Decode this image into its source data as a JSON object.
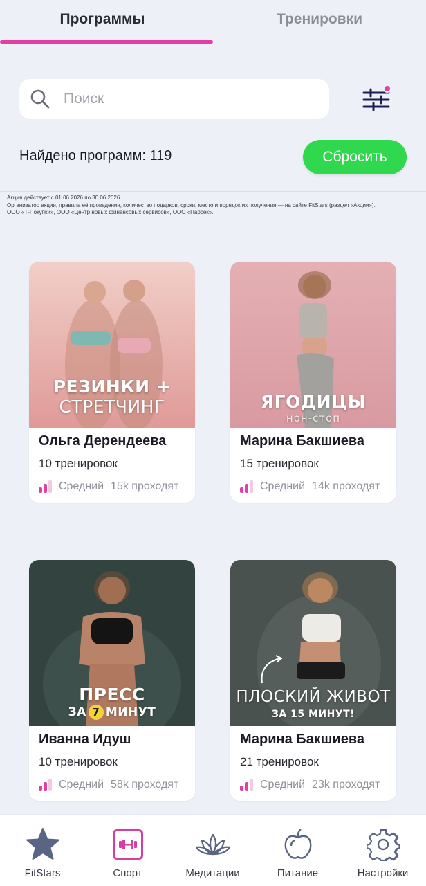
{
  "tabs": {
    "programs": "Программы",
    "workouts": "Тренировки"
  },
  "search": {
    "placeholder": "Поиск"
  },
  "results": {
    "found_label": "Найдено программ: 119",
    "reset_label": "Сбросить"
  },
  "disclaimer": {
    "line1": "Акция действует с 01.06.2026 по 30.06.2026.",
    "line2": "Организатор акции, правила её проведения, количество подарков, сроки, место и порядок их получения — на сайте FitStars (раздел «Акции»).",
    "line3": "ООО «Т-Покупки», ООО «Центр новых финансовых сервисов», ООО «Парсек»."
  },
  "programs": [
    {
      "caption_main": "РЕЗИНКИ +",
      "caption_second": "СТРЕТЧИНГ",
      "trainer": "Ольга Дерендеева",
      "workouts": "10 тренировок",
      "level": "Средний",
      "participants": "15k проходят"
    },
    {
      "caption_main": "ЯГОДИЦЫ",
      "caption_second": "нон-стоп",
      "trainer": "Марина Бакшиева",
      "workouts": "15 тренировок",
      "level": "Средний",
      "participants": "14k проходят"
    },
    {
      "caption_main": "ПРЕСС",
      "caption_pre": "ЗА",
      "caption_number": "7",
      "caption_post": "МИНУТ",
      "trainer": "Иванна Идуш",
      "workouts": "10 тренировок",
      "level": "Средний",
      "participants": "58k проходят"
    },
    {
      "caption_main": "ПЛОСКИЙ ЖИВОТ",
      "caption_second": "ЗА 15 МИНУТ!",
      "trainer": "Марина Бакшиева",
      "workouts": "21 тренировок",
      "level": "Средний",
      "participants": "23k проходят"
    }
  ],
  "nav": [
    {
      "label": "FitStars",
      "icon": "star-icon"
    },
    {
      "label": "Спорт",
      "icon": "dumbbell-icon"
    },
    {
      "label": "Медитации",
      "icon": "lotus-icon"
    },
    {
      "label": "Питание",
      "icon": "apple-icon"
    },
    {
      "label": "Настройки",
      "icon": "gear-icon"
    }
  ],
  "colors": {
    "accent": "#e23fa4",
    "reset_green": "#2fd84c",
    "background": "#eef0f8"
  }
}
